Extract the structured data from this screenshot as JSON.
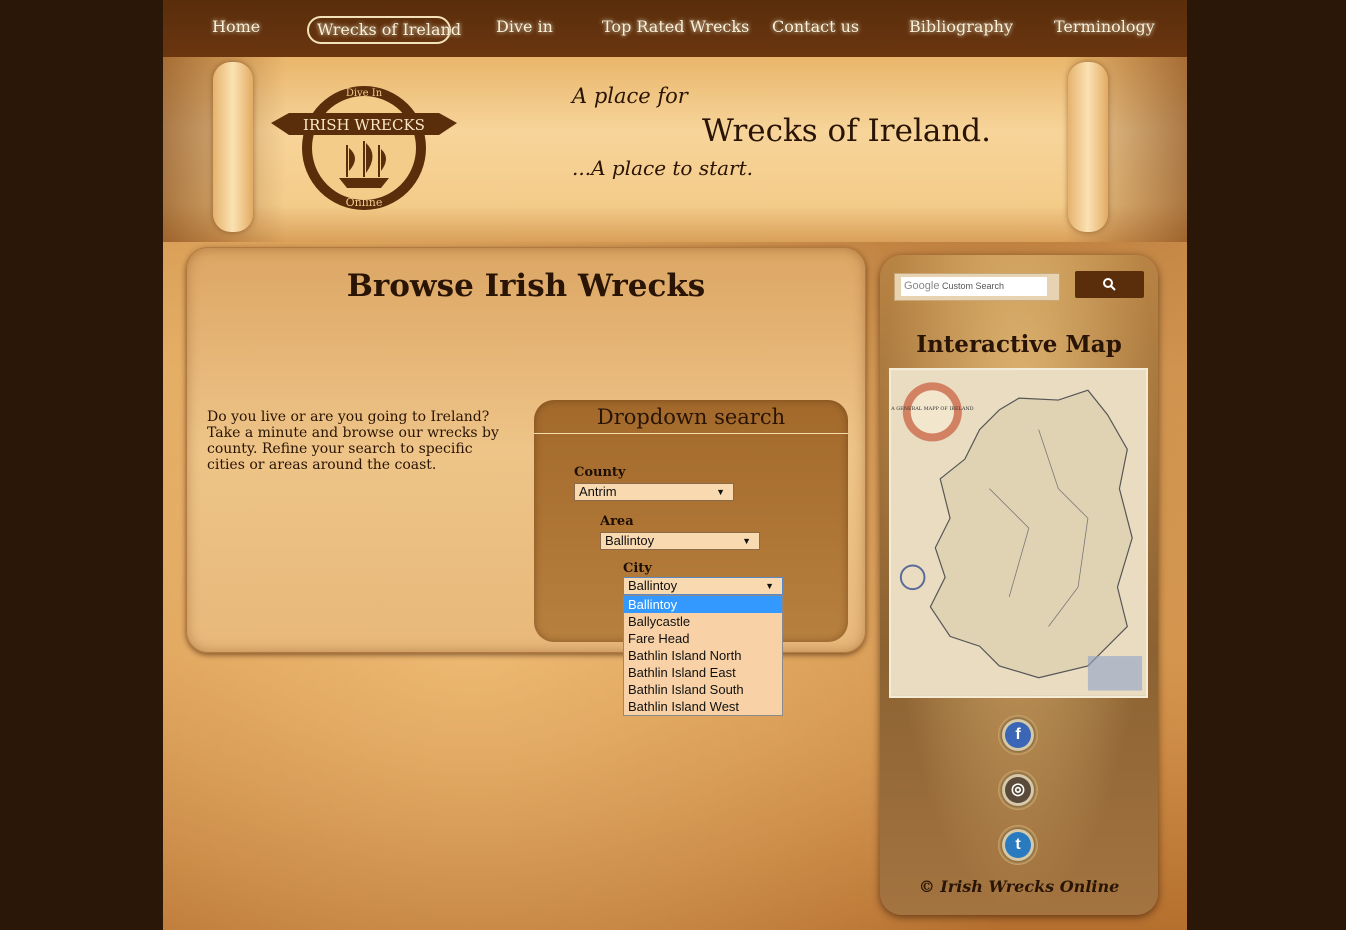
{
  "nav": {
    "items": [
      {
        "label": "Home"
      },
      {
        "label": "Wrecks of Ireland"
      },
      {
        "label": "Dive in"
      },
      {
        "label": "Top Rated Wrecks"
      },
      {
        "label": "Contact us"
      },
      {
        "label": "Bibliography"
      },
      {
        "label": "Terminology"
      }
    ]
  },
  "banner": {
    "logo_top": "Dive In",
    "logo_ribbon": "IRISH WRECKS",
    "logo_bottom": "Online",
    "tagline_1": "A place for",
    "tagline_2": "Wrecks of Ireland.",
    "tagline_3": "...A place to start."
  },
  "main": {
    "title": "Browse Irish Wrecks",
    "intro": "Do you live or are you going to Ireland? Take a minute and browse our wrecks by county. Refine your search to specific cities or areas around the coast."
  },
  "dropdown_search": {
    "title": "Dropdown search",
    "county_label": "County",
    "county_value": "Antrim",
    "area_label": "Area",
    "area_value": "Ballintoy",
    "city_label": "City",
    "city_value": "Ballintoy",
    "city_options": [
      "Ballintoy",
      "Ballycastle",
      "Fare Head",
      "Bathlin Island North",
      "Bathlin Island East",
      "Bathlin Island South",
      "Bathlin Island West"
    ]
  },
  "sidebar": {
    "search_placeholder": "Custom Search",
    "search_brand": "Google",
    "map_title": "Interactive Map",
    "map_caption": "A GENERAL MAPP OF IRELAND",
    "copyright": "© Irish Wrecks Online"
  },
  "icons": {
    "search": "magnifier-icon",
    "facebook": "facebook-icon",
    "instagram": "instagram-icon",
    "twitter": "twitter-icon"
  },
  "colors": {
    "nav_bg": "#5a2d0b",
    "text_dark": "#2a1405",
    "list_selected": "#3399ff",
    "dropdown_bg": "#f8d9b0"
  }
}
